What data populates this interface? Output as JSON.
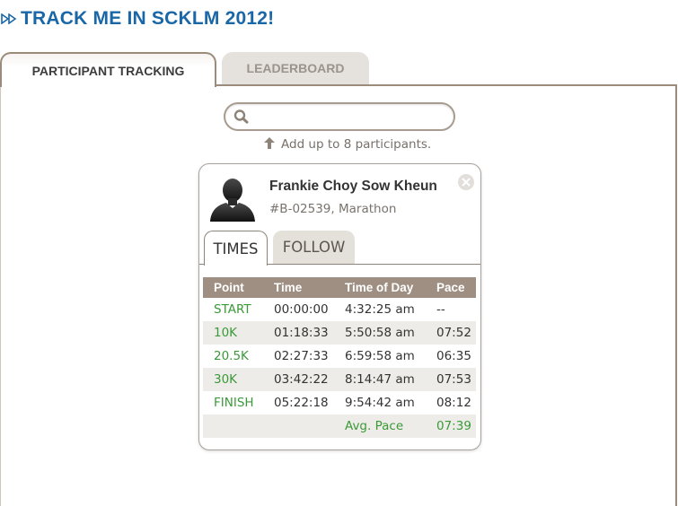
{
  "page": {
    "title": "TRACK ME IN SCKLM 2012!"
  },
  "tabs": [
    {
      "label": "PARTICIPANT TRACKING",
      "active": true
    },
    {
      "label": "LEADERBOARD",
      "active": false
    }
  ],
  "search": {
    "value": "",
    "placeholder": ""
  },
  "hint": {
    "text": "Add up to 8 participants."
  },
  "participant": {
    "name": "Frankie Choy Sow Kheun",
    "meta": "#B-02539, Marathon",
    "tabs": [
      {
        "label": "TIMES",
        "active": true
      },
      {
        "label": "FOLLOW",
        "active": false
      }
    ],
    "table": {
      "headers": [
        "Point",
        "Time",
        "Time of Day",
        "Pace"
      ],
      "rows": [
        [
          "START",
          "00:00:00",
          "4:32:25 am",
          "--"
        ],
        [
          "10K",
          "01:18:33",
          "5:50:58 am",
          "07:52"
        ],
        [
          "20.5K",
          "02:27:33",
          "6:59:58 am",
          "06:35"
        ],
        [
          "30K",
          "03:42:22",
          "8:14:47 am",
          "07:53"
        ],
        [
          "FINISH",
          "05:22:18",
          "9:54:42 am",
          "08:12"
        ]
      ],
      "avg_label": "Avg. Pace",
      "avg_value": "07:39"
    }
  },
  "colors": {
    "title": "#1a67a8",
    "tab_border": "#9c8b7a",
    "table_header": "#9e8f82",
    "point_green": "#3a9a38"
  },
  "icons": [
    "double-arrow-icon",
    "search-icon",
    "up-arrow-icon",
    "avatar-silhouette-icon",
    "close-icon"
  ]
}
